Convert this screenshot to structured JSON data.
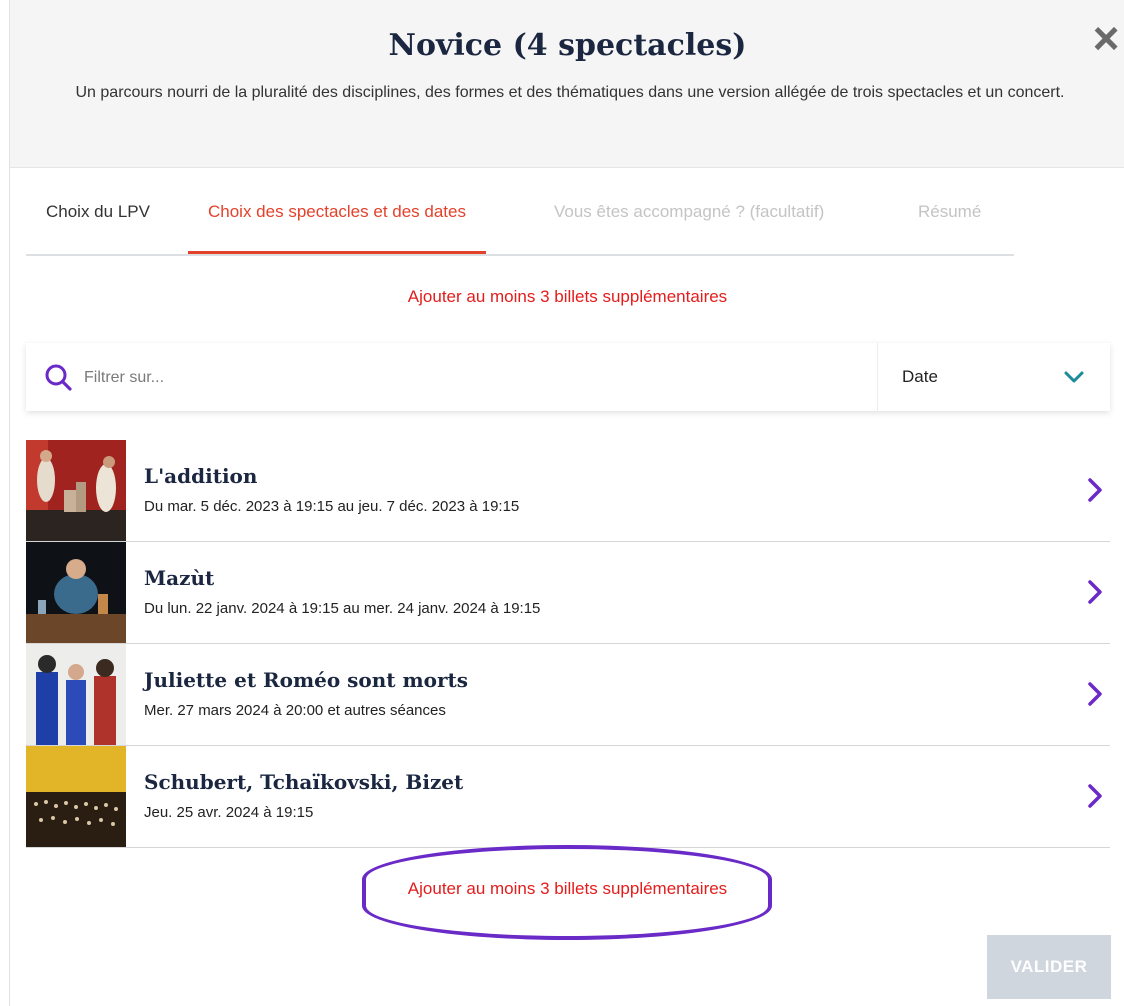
{
  "modal": {
    "title": "Novice (4 spectacles)",
    "subtitle": "Un parcours nourri de la pluralité des disciplines, des formes et des thématiques dans une version allégée de trois spectacles et un concert.",
    "close_icon": "close-icon"
  },
  "tabs": [
    {
      "label": "Choix du LPV",
      "state": "done"
    },
    {
      "label": "Choix des spectacles et des dates",
      "state": "active"
    },
    {
      "label": "Vous êtes accompagné ? (facultatif)",
      "state": "disabled"
    },
    {
      "label": "Résumé",
      "state": "disabled"
    }
  ],
  "warning_top": "Ajouter au moins 3 billets supplémentaires",
  "search": {
    "placeholder": "Filtrer sur...",
    "value": "",
    "icon": "search-icon"
  },
  "sort": {
    "selected": "Date",
    "icon": "chevron-down-icon"
  },
  "shows": [
    {
      "title": "L'addition",
      "dates": "Du mar. 5 déc. 2023 à 19:15 au jeu. 7 déc. 2023 à 19:15"
    },
    {
      "title": "Mazùt",
      "dates": "Du lun. 22 janv. 2024 à 19:15 au mer. 24 janv. 2024 à 19:15"
    },
    {
      "title": "Juliette et Roméo sont morts",
      "dates": "Mer. 27 mars 2024 à 20:00 et autres séances"
    },
    {
      "title": "Schubert, Tchaïkovski, Bizet",
      "dates": "Jeu. 25 avr. 2024 à 19:15"
    }
  ],
  "warning_bottom": "Ajouter au moins 3 billets supplémentaires",
  "validate_label": "VALIDER",
  "colors": {
    "accent": "#e4412b",
    "warning": "#e31c1c",
    "chevron": "#6a2ac7",
    "sort_chevron": "#1b8a9a",
    "title": "#1b2741",
    "annotation_circle": "#6a2ac7",
    "button_disabled": "#cfd6dd"
  }
}
